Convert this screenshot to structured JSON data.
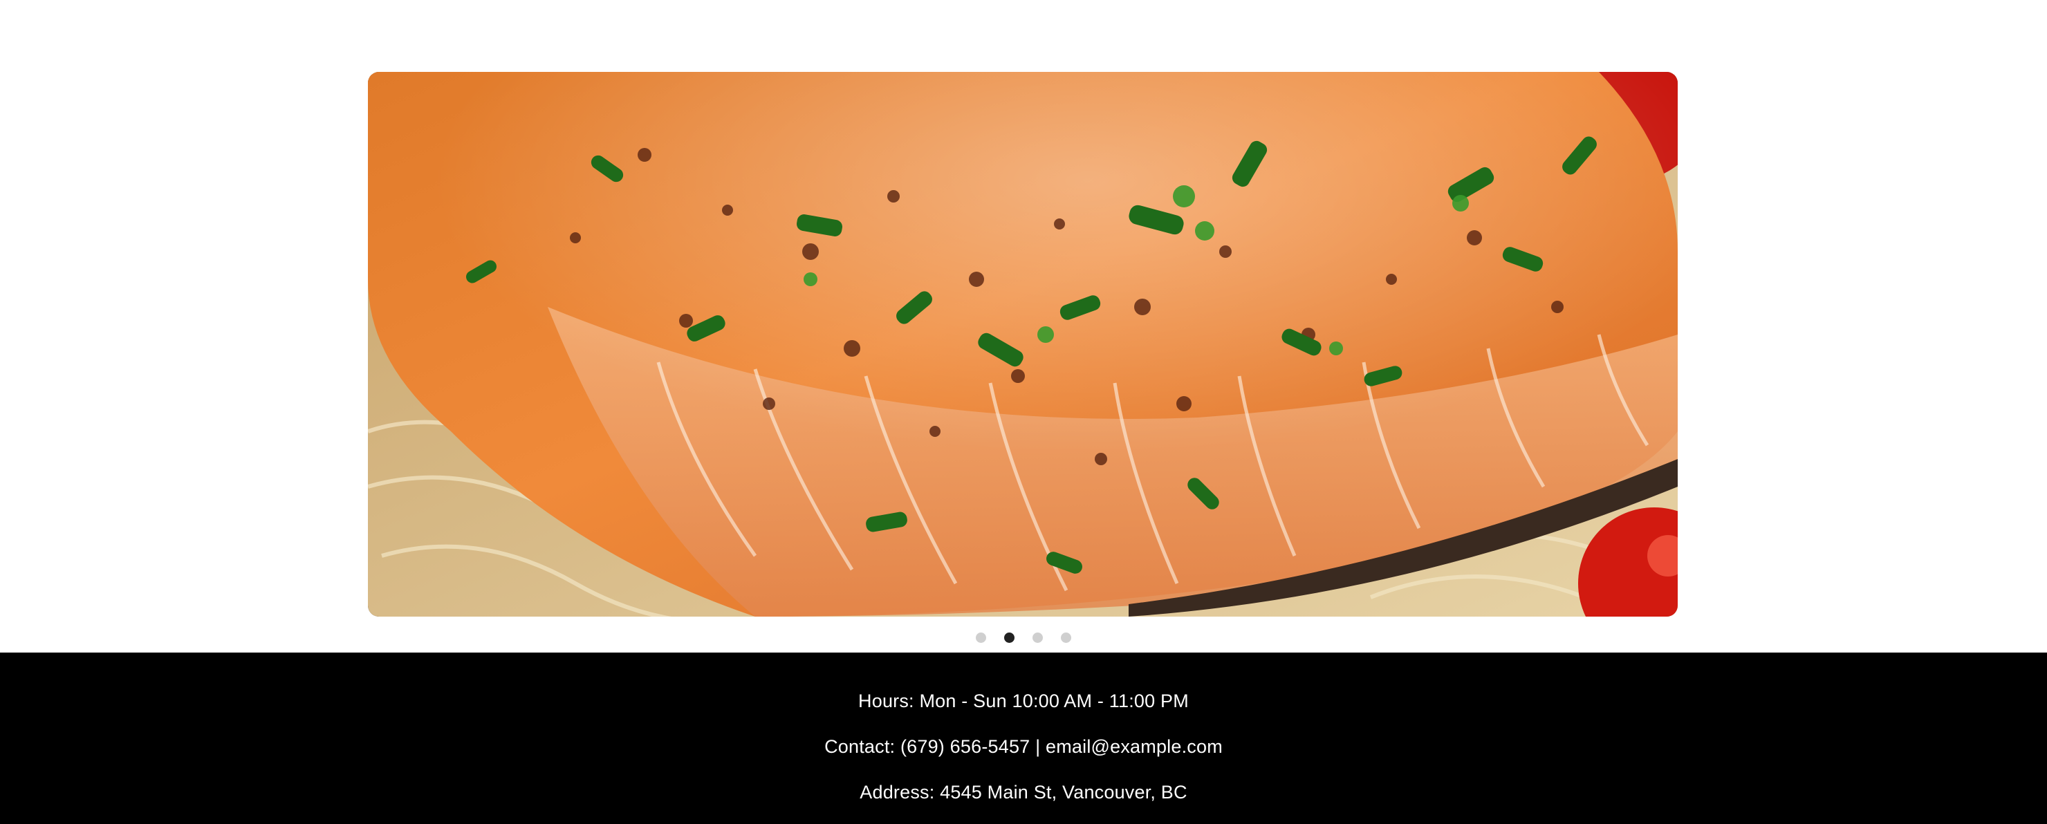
{
  "hero": {
    "image_description_icon": "salmon-photo",
    "active_slide_index": 2,
    "total_slides": 4
  },
  "carousel_dots": [
    {
      "label": "",
      "active": false
    },
    {
      "label": "",
      "active": true
    },
    {
      "label": "",
      "active": false
    },
    {
      "label": "",
      "active": false
    }
  ],
  "footer": {
    "hours": "Hours: Mon - Sun 10:00 AM - 11:00 PM",
    "contact": "Contact: (679) 656-5457 | email@example.com",
    "address": "Address: 4545 Main St, Vancouver, BC"
  },
  "colors": {
    "footer_bg": "#000000",
    "footer_text": "#ffffff",
    "dot_inactive": "#cfcfcf",
    "dot_active": "#222222"
  }
}
